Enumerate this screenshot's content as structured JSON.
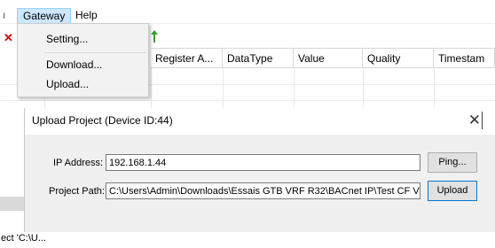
{
  "menubar": {
    "left_edge": "ı",
    "gateway": "Gateway",
    "help": "Help"
  },
  "dropdown": {
    "items": [
      "Setting...",
      "Download...",
      "Upload..."
    ]
  },
  "grid": {
    "columns": [
      "Register A...",
      "DataType",
      "Value",
      "Quality",
      "Timestam"
    ]
  },
  "dialog": {
    "title": "Upload Project (Device ID:44)",
    "close": "✕",
    "ip_label": "IP Address:",
    "ip_value": "192.168.1.44",
    "ping_label": "Ping...",
    "path_label": "Project Path:",
    "path_value": "C:\\Users\\Admin\\Downloads\\Essais GTB VRF R32\\BACnet IP\\Test CF V",
    "upload_label": "Upload"
  },
  "status": {
    "text": "ect 'C:\\U..."
  },
  "colors": {
    "menu_highlight": "#cce8ff",
    "default_button_border": "#0078d7"
  }
}
